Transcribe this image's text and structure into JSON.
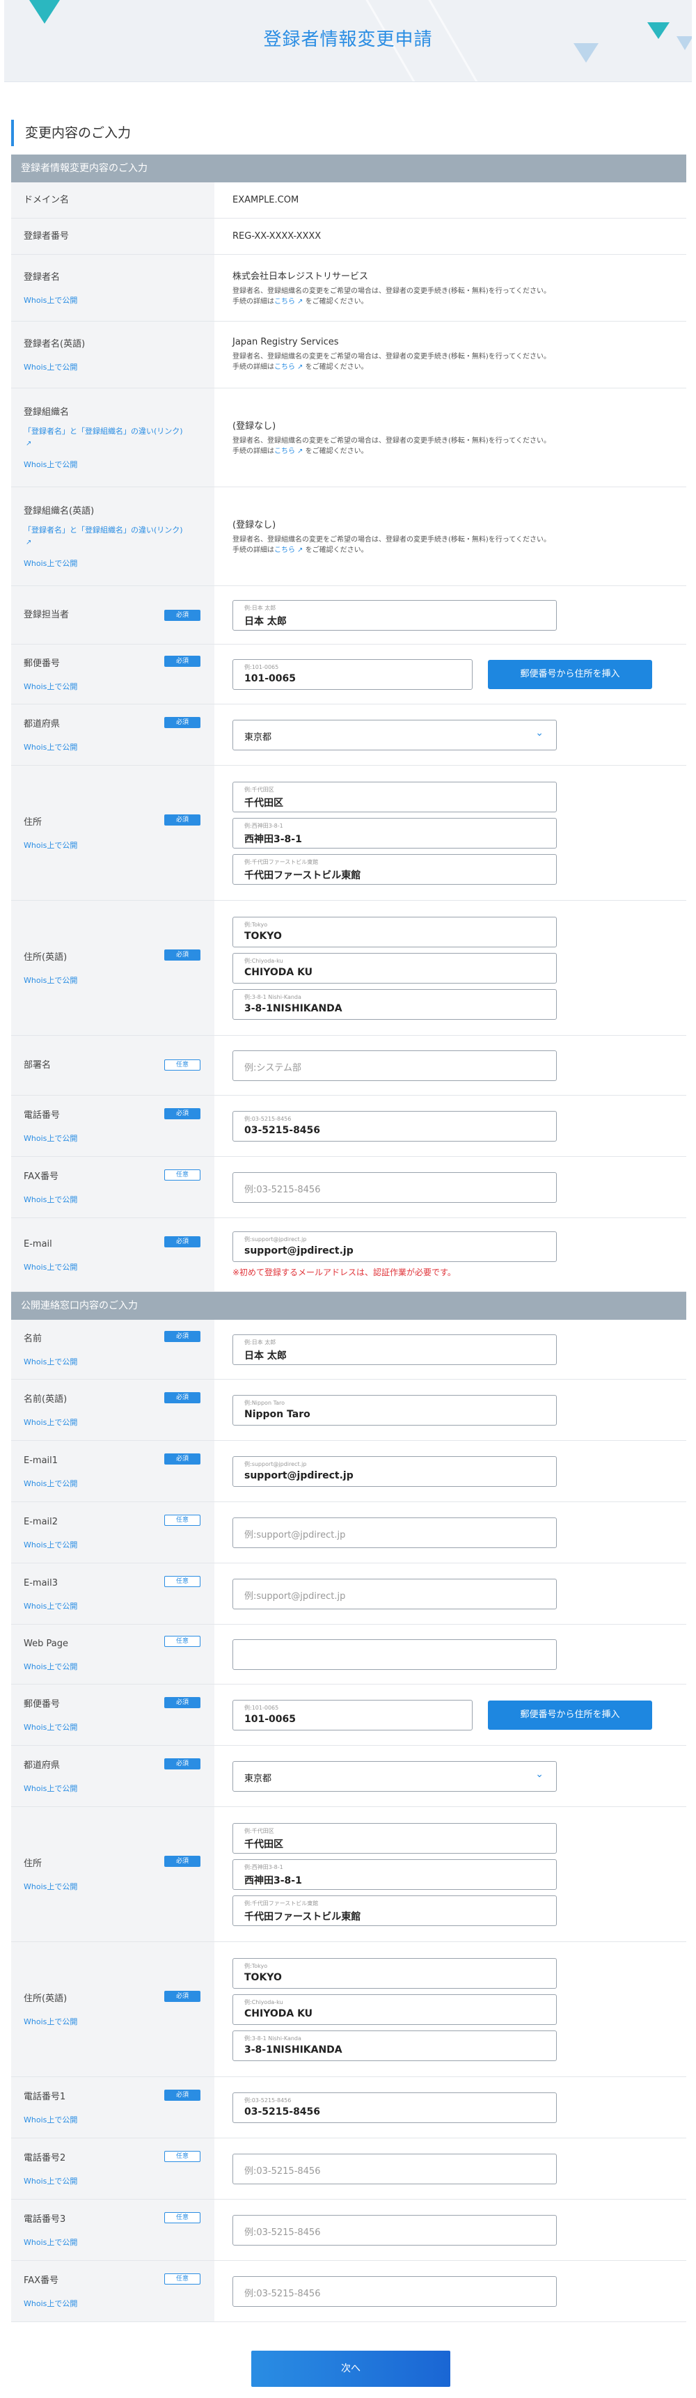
{
  "header": {
    "title": "登録者情報変更申請"
  },
  "section_title": "変更内容のご入力",
  "band1": "登録者情報変更内容のご入力",
  "band2": "公開連絡窓口内容のご入力",
  "whois_label": "Whois上で公開",
  "note_text": "登録者名、登録組織名の変更をご希望の場合は、登録者の変更手続き(移転・無料)を行ってください。",
  "note_link_pre": "手続の詳細は",
  "note_link": "こちら",
  "note_link_post": " をご確認ください。",
  "diff_link": "「登録者名」と「登録組織名」の違い(リンク)",
  "badge_req": "必須",
  "badge_opt": "任意",
  "zip_button": "郵便番号から住所を挿入",
  "email_warning": "※初めて登録するメールアドレスは、認証作業が必要です。",
  "next_button": "次へ",
  "registrant": {
    "domain": {
      "label": "ドメイン名",
      "value": "EXAMPLE.COM"
    },
    "regno": {
      "label": "登録者番号",
      "value": "REG-XX-XXXX-XXXX"
    },
    "name": {
      "label": "登録者名",
      "value": "株式会社日本レジストリサービス"
    },
    "name_en": {
      "label": "登録者名(英語)",
      "value": "Japan Registry Services"
    },
    "org": {
      "label": "登録組織名",
      "value": "(登録なし)"
    },
    "org_en": {
      "label": "登録組織名(英語)",
      "value": "(登録なし)"
    },
    "contact": {
      "label": "登録担当者",
      "sm": "例:日本 太郎",
      "value": "日本 太郎"
    },
    "zip": {
      "label": "郵便番号",
      "sm": "例:101-0065",
      "value": "101-0065"
    },
    "pref": {
      "label": "都道府県",
      "value": "東京都"
    },
    "addr": {
      "label": "住所",
      "lines": [
        {
          "sm": "例:千代田区",
          "value": "千代田区"
        },
        {
          "sm": "例:西神田3-8-1",
          "value": "西神田3-8-1"
        },
        {
          "sm": "例:千代田ファーストビル東館",
          "value": "千代田ファーストビル東館"
        }
      ]
    },
    "addr_en": {
      "label": "住所(英語)",
      "lines": [
        {
          "sm": "例:Tokyo",
          "value": "TOKYO"
        },
        {
          "sm": "例:Chiyoda-ku",
          "value": "CHIYODA KU"
        },
        {
          "sm": "例:3-8-1 Nishi-Kanda",
          "value": "3-8-1NISHIKANDA"
        }
      ]
    },
    "dept": {
      "label": "部署名",
      "placeholder": "例:システム部"
    },
    "tel": {
      "label": "電話番号",
      "sm": "例:03-5215-8456",
      "value": "03-5215-8456"
    },
    "fax": {
      "label": "FAX番号",
      "placeholder": "例:03-5215-8456"
    },
    "email": {
      "label": "E-mail",
      "sm": "例:support@jpdirect.jp",
      "value": "support@jpdirect.jp"
    }
  },
  "public": {
    "name": {
      "label": "名前",
      "sm": "例:日本 太郎",
      "value": "日本 太郎"
    },
    "name_en": {
      "label": "名前(英語)",
      "sm": "例:Nippon Taro",
      "value": "Nippon Taro"
    },
    "email1": {
      "label": "E-mail1",
      "sm": "例:support@jpdirect.jp",
      "value": "support@jpdirect.jp"
    },
    "email2": {
      "label": "E-mail2",
      "placeholder": "例:support@jpdirect.jp"
    },
    "email3": {
      "label": "E-mail3",
      "placeholder": "例:support@jpdirect.jp"
    },
    "web": {
      "label": "Web Page",
      "placeholder": ""
    },
    "zip": {
      "label": "郵便番号",
      "sm": "例:101-0065",
      "value": "101-0065"
    },
    "pref": {
      "label": "都道府県",
      "value": "東京都"
    },
    "addr": {
      "label": "住所",
      "lines": [
        {
          "sm": "例:千代田区",
          "value": "千代田区"
        },
        {
          "sm": "例:西神田3-8-1",
          "value": "西神田3-8-1"
        },
        {
          "sm": "例:千代田ファーストビル東館",
          "value": "千代田ファーストビル東館"
        }
      ]
    },
    "addr_en": {
      "label": "住所(英語)",
      "lines": [
        {
          "sm": "例:Tokyo",
          "value": "TOKYO"
        },
        {
          "sm": "例:Chiyoda-ku",
          "value": "CHIYODA KU"
        },
        {
          "sm": "例:3-8-1 Nishi-Kanda",
          "value": "3-8-1NISHIKANDA"
        }
      ]
    },
    "tel1": {
      "label": "電話番号1",
      "sm": "例:03-5215-8456",
      "value": "03-5215-8456"
    },
    "tel2": {
      "label": "電話番号2",
      "placeholder": "例:03-5215-8456"
    },
    "tel3": {
      "label": "電話番号3",
      "placeholder": "例:03-5215-8456"
    },
    "fax": {
      "label": "FAX番号",
      "placeholder": "例:03-5215-8456"
    }
  }
}
